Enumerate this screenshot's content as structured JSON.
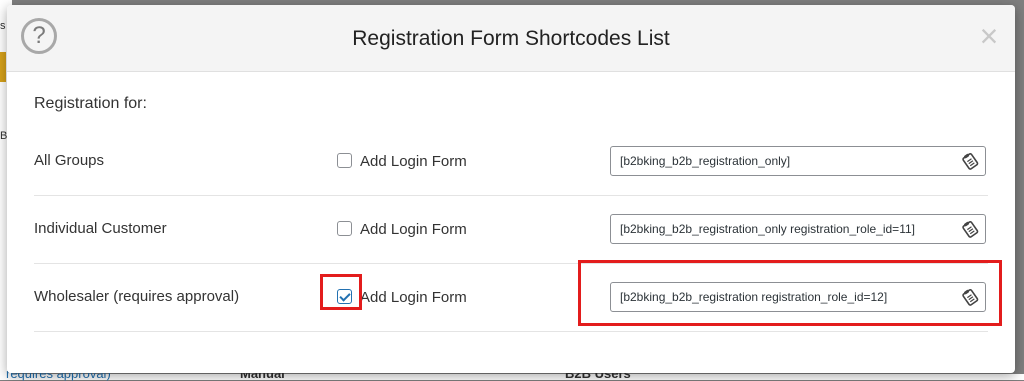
{
  "modal": {
    "title": "Registration Form Shortcodes List",
    "section_title": "Registration for:",
    "rows": [
      {
        "label": "All Groups",
        "checkbox_label": "Add Login Form",
        "checked": false,
        "shortcode": "[b2bking_b2b_registration_only]"
      },
      {
        "label": "Individual Customer",
        "checkbox_label": "Add Login Form",
        "checked": false,
        "shortcode": "[b2bking_b2b_registration_only registration_role_id=11]"
      },
      {
        "label": "Wholesaler (requires approval)",
        "checkbox_label": "Add Login Form",
        "checked": true,
        "shortcode": "[b2bking_b2b_registration registration_role_id=12]"
      }
    ]
  },
  "background": {
    "fragment_top": "s",
    "fragment_mid": "B",
    "bottom_left": "requires approval)",
    "bottom_mid": "Manual",
    "bottom_right": "B2B Users"
  },
  "colors": {
    "highlight": "#e31c1c",
    "checkbox_accent": "#2271b1"
  }
}
